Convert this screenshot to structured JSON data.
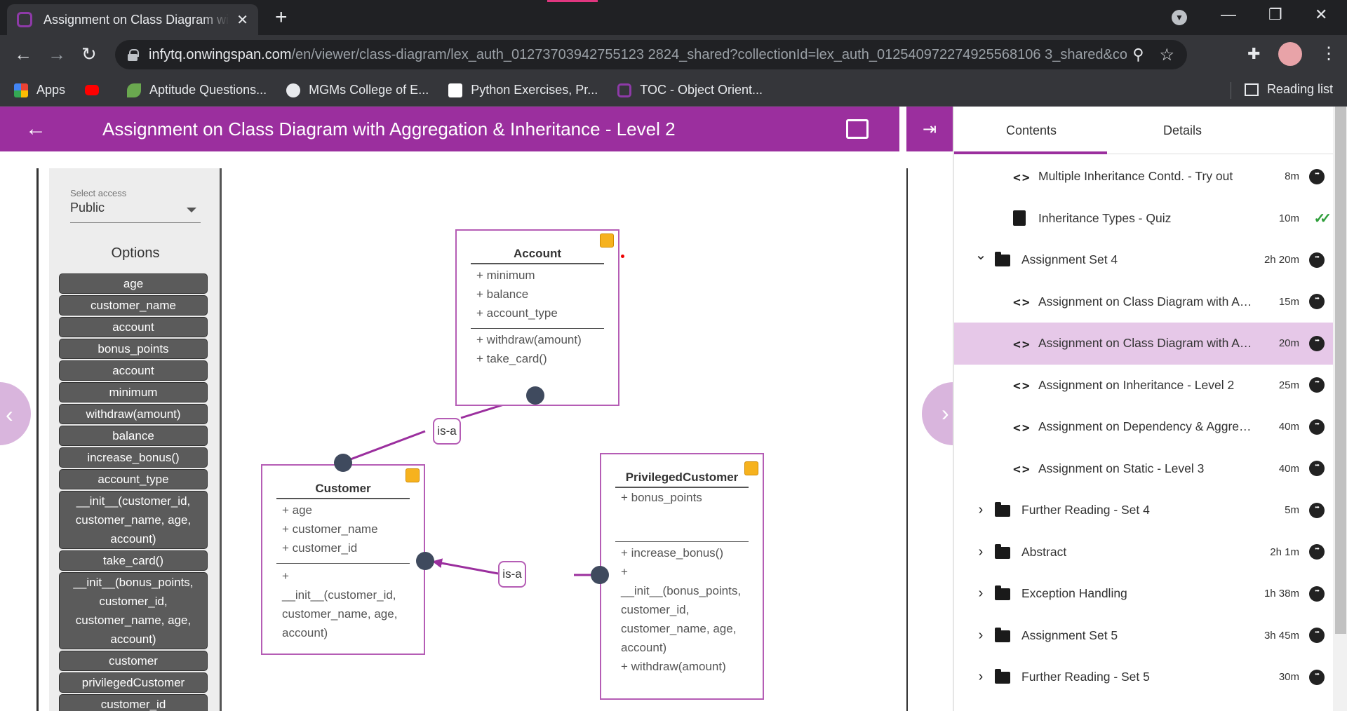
{
  "browser": {
    "tab_title": "Assignment on Class Diagram with Aggregation & Inheritance - Level 2",
    "url_host": "infytq.onwingspan.com",
    "url_path": "/en/viewer/class-diagram/lex_auth_01273703942755123 2824_shared?collectionId=lex_auth_012540972274925568106 3_shared&co...",
    "bookmarks": [
      {
        "label": "Apps",
        "icon": "apps-grid-icon",
        "color": "#ea4335"
      },
      {
        "label": "",
        "icon": "youtube-icon",
        "color": "#ff0000"
      },
      {
        "label": "Aptitude Questions...",
        "icon": "leaf-icon",
        "color": "#6aa84f"
      },
      {
        "label": "MGMs College of E...",
        "icon": "globe-icon",
        "color": "#e8eaed"
      },
      {
        "label": "Python Exercises, Pr...",
        "icon": "w3r-icon",
        "color": "#ffffff"
      },
      {
        "label": "TOC - Object Orient...",
        "icon": "infytq-icon",
        "color": "#8e3aa8"
      }
    ],
    "reading_list": "Reading list"
  },
  "page": {
    "title": "Assignment on Class Diagram with Aggregation & Inheritance - Level 2",
    "accent": "#9b2f9e"
  },
  "palette": {
    "select_label": "Select access",
    "select_value": "Public",
    "options_title": "Options",
    "options": [
      "age",
      "customer_name",
      "account",
      "bonus_points",
      "account",
      "minimum",
      "withdraw(amount)",
      "balance",
      "increase_bonus()",
      "account_type",
      "__init__(customer_id, customer_name, age, account)",
      "take_card()",
      "__init__(bonus_points, customer_id, customer_name, age, account)",
      "customer",
      "privilegedCustomer",
      "customer_id"
    ]
  },
  "diagram": {
    "account": {
      "name": "Account",
      "attributes": [
        "+ minimum",
        "+ balance",
        "+ account_type"
      ],
      "methods": [
        "+ withdraw(amount)",
        "+ take_card()"
      ]
    },
    "customer": {
      "name": "Customer",
      "attributes": [
        "+ age",
        "+ customer_name",
        "+ customer_id"
      ],
      "methods": [
        "+",
        "__init__(customer_id,",
        "customer_name, age,",
        "account)"
      ]
    },
    "privileged": {
      "name": "PrivilegedCustomer",
      "attributes": [
        "+ bonus_points"
      ],
      "methods": [
        "+ increase_bonus()",
        "+",
        "__init__(bonus_points,",
        "customer_id,",
        "customer_name, age,",
        "account)",
        "+ withdraw(amount)"
      ]
    },
    "relation1": "is-a",
    "relation2": "is-a"
  },
  "sidebar": {
    "tab_contents": "Contents",
    "tab_details": "Details",
    "items": [
      {
        "type": "code",
        "label": "Multiple Inheritance Contd. - Try out",
        "dur": "8m",
        "indent": 1
      },
      {
        "type": "quiz",
        "label": "Inheritance Types - Quiz",
        "dur": "10m",
        "indent": 1,
        "done": true
      },
      {
        "type": "folder",
        "label": "Assignment Set 4",
        "dur": "2h 20m",
        "indent": 0,
        "expanded": true
      },
      {
        "type": "code",
        "label": "Assignment on Class Diagram with Ag...",
        "dur": "15m",
        "indent": 1
      },
      {
        "type": "code",
        "label": "Assignment on Class Diagram with Ag...",
        "dur": "20m",
        "indent": 1,
        "active": true
      },
      {
        "type": "code",
        "label": "Assignment on Inheritance - Level 2",
        "dur": "25m",
        "indent": 1
      },
      {
        "type": "code",
        "label": "Assignment on Dependency & Aggreg...",
        "dur": "40m",
        "indent": 1
      },
      {
        "type": "code",
        "label": "Assignment on Static - Level 3",
        "dur": "40m",
        "indent": 1
      },
      {
        "type": "folder",
        "label": "Further Reading - Set 4",
        "dur": "5m",
        "indent": 0
      },
      {
        "type": "folder",
        "label": "Abstract",
        "dur": "2h 1m",
        "indent": 0
      },
      {
        "type": "folder",
        "label": "Exception Handling",
        "dur": "1h 38m",
        "indent": 0
      },
      {
        "type": "folder",
        "label": "Assignment Set 5",
        "dur": "3h 45m",
        "indent": 0
      },
      {
        "type": "folder",
        "label": "Further Reading - Set 5",
        "dur": "30m",
        "indent": 0
      }
    ]
  }
}
